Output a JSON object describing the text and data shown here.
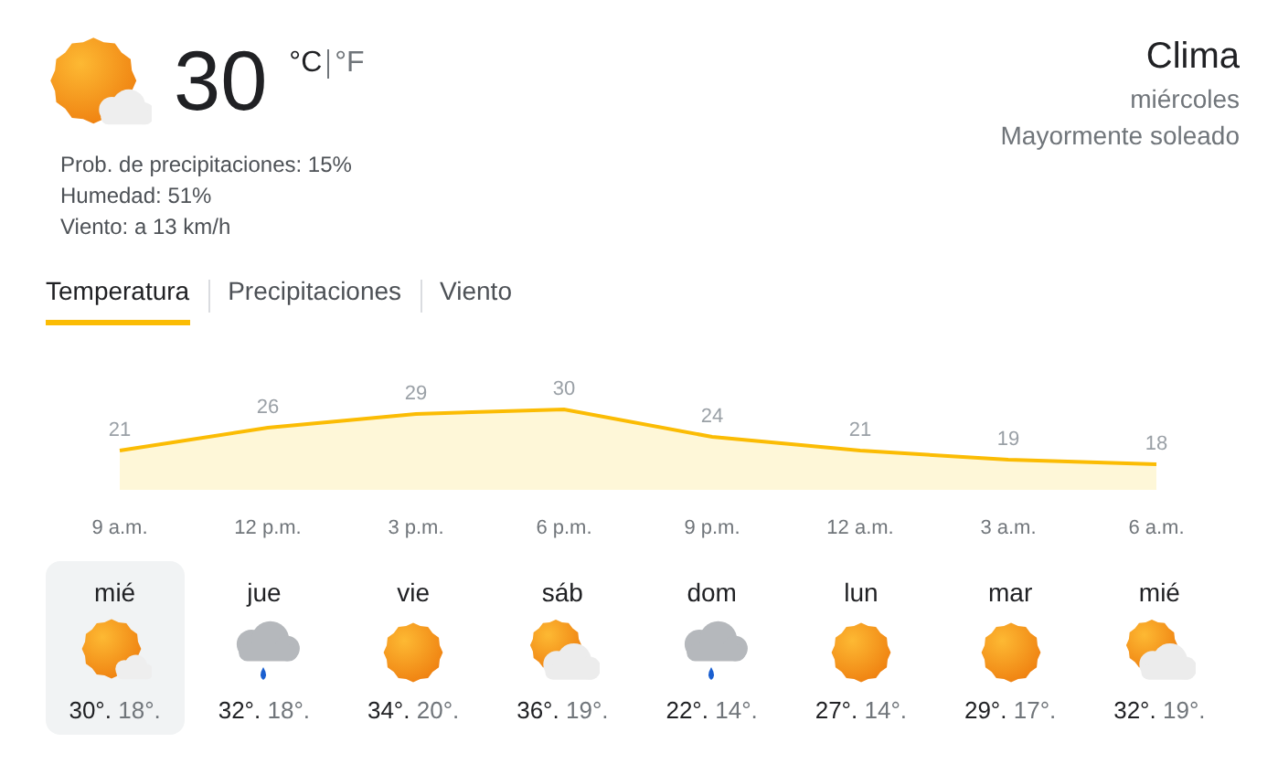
{
  "current": {
    "kind": "partly-cloudy",
    "temperature": "30",
    "units": [
      {
        "label": "°C",
        "selected": true
      },
      {
        "label": "°F",
        "selected": false
      }
    ],
    "details": [
      "Prob. de precipitaciones: 15%",
      "Humedad: 51%",
      "Viento: a 13 km/h"
    ]
  },
  "header": {
    "title": "Clima",
    "day": "miércoles",
    "condition": "Mayormente soleado"
  },
  "tabs": [
    {
      "label": "Temperatura",
      "selected": true
    },
    {
      "label": "Precipitaciones",
      "selected": false
    },
    {
      "label": "Viento",
      "selected": false
    }
  ],
  "chart_data": {
    "type": "area",
    "categories": [
      "9 a.m.",
      "12 p.m.",
      "3 p.m.",
      "6 p.m.",
      "9 p.m.",
      "12 a.m.",
      "3 a.m.",
      "6 a.m."
    ],
    "series": [
      {
        "color": "#fbbc04",
        "values": [
          21,
          26,
          29,
          30,
          24,
          21,
          19,
          18
        ]
      }
    ],
    "data_labels": true
  },
  "days": [
    {
      "day": "mié",
      "kind": "partly-cloudy",
      "high": "30°.",
      "low": "18°.",
      "selected": true
    },
    {
      "day": "jue",
      "kind": "rain",
      "high": "32°.",
      "low": "18°.",
      "selected": false
    },
    {
      "day": "vie",
      "kind": "sunny",
      "high": "34°.",
      "low": "20°.",
      "selected": false
    },
    {
      "day": "sáb",
      "kind": "mostly-cloudy",
      "high": "36°.",
      "low": "19°.",
      "selected": false
    },
    {
      "day": "dom",
      "kind": "rain",
      "high": "22°.",
      "low": "14°.",
      "selected": false
    },
    {
      "day": "lun",
      "kind": "sunny",
      "high": "27°.",
      "low": "14°.",
      "selected": false
    },
    {
      "day": "mar",
      "kind": "sunny",
      "high": "29°.",
      "low": "17°.",
      "selected": false
    },
    {
      "day": "mié",
      "kind": "mostly-cloudy",
      "high": "32°.",
      "low": "19°.",
      "selected": false
    }
  ]
}
